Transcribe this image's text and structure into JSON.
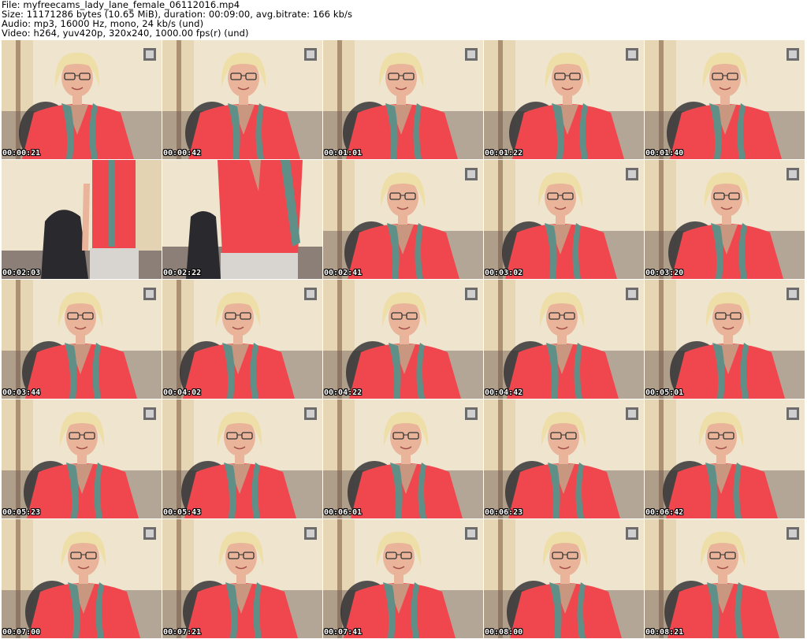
{
  "header": {
    "file": "File: myfreecams_lady_lane_female_06112016.mp4",
    "size": "Size: 11171286 bytes (10.65 MiB), duration: 00:09:00, avg.bitrate: 166 kb/s",
    "audio": "Audio: mp3, 16000 Hz, mono, 24 kb/s (und)",
    "video": "Video: h264, yuv420p, 320x240, 1000.00 fps(r) (und)"
  },
  "thumbnails": [
    {
      "timestamp": "00:00:21",
      "scene": "portrait"
    },
    {
      "timestamp": "00:00:42",
      "scene": "portrait"
    },
    {
      "timestamp": "00:01:01",
      "scene": "portrait"
    },
    {
      "timestamp": "00:01:22",
      "scene": "portrait"
    },
    {
      "timestamp": "00:01:40",
      "scene": "portrait"
    },
    {
      "timestamp": "00:02:03",
      "scene": "standing-side"
    },
    {
      "timestamp": "00:02:22",
      "scene": "standing-front"
    },
    {
      "timestamp": "00:02:41",
      "scene": "portrait"
    },
    {
      "timestamp": "00:03:02",
      "scene": "portrait"
    },
    {
      "timestamp": "00:03:20",
      "scene": "portrait"
    },
    {
      "timestamp": "00:03:44",
      "scene": "portrait"
    },
    {
      "timestamp": "00:04:02",
      "scene": "portrait"
    },
    {
      "timestamp": "00:04:22",
      "scene": "portrait"
    },
    {
      "timestamp": "00:04:42",
      "scene": "portrait"
    },
    {
      "timestamp": "00:05:01",
      "scene": "portrait"
    },
    {
      "timestamp": "00:05:23",
      "scene": "portrait"
    },
    {
      "timestamp": "00:05:43",
      "scene": "portrait"
    },
    {
      "timestamp": "00:06:01",
      "scene": "portrait"
    },
    {
      "timestamp": "00:06:23",
      "scene": "portrait"
    },
    {
      "timestamp": "00:06:42",
      "scene": "portrait"
    },
    {
      "timestamp": "00:07:00",
      "scene": "portrait"
    },
    {
      "timestamp": "00:07:21",
      "scene": "portrait"
    },
    {
      "timestamp": "00:07:41",
      "scene": "portrait"
    },
    {
      "timestamp": "00:08:00",
      "scene": "portrait"
    },
    {
      "timestamp": "00:08:21",
      "scene": "portrait"
    }
  ],
  "colors": {
    "wall": "#efe4cd",
    "jacket": "#f0474f",
    "hair": "#eedfa8",
    "skin": "#e9b49a",
    "chair": "#2a2a2e",
    "scarf": "#5f8f86",
    "timestamp_text": "#ffffff",
    "timestamp_outline": "#000000"
  }
}
